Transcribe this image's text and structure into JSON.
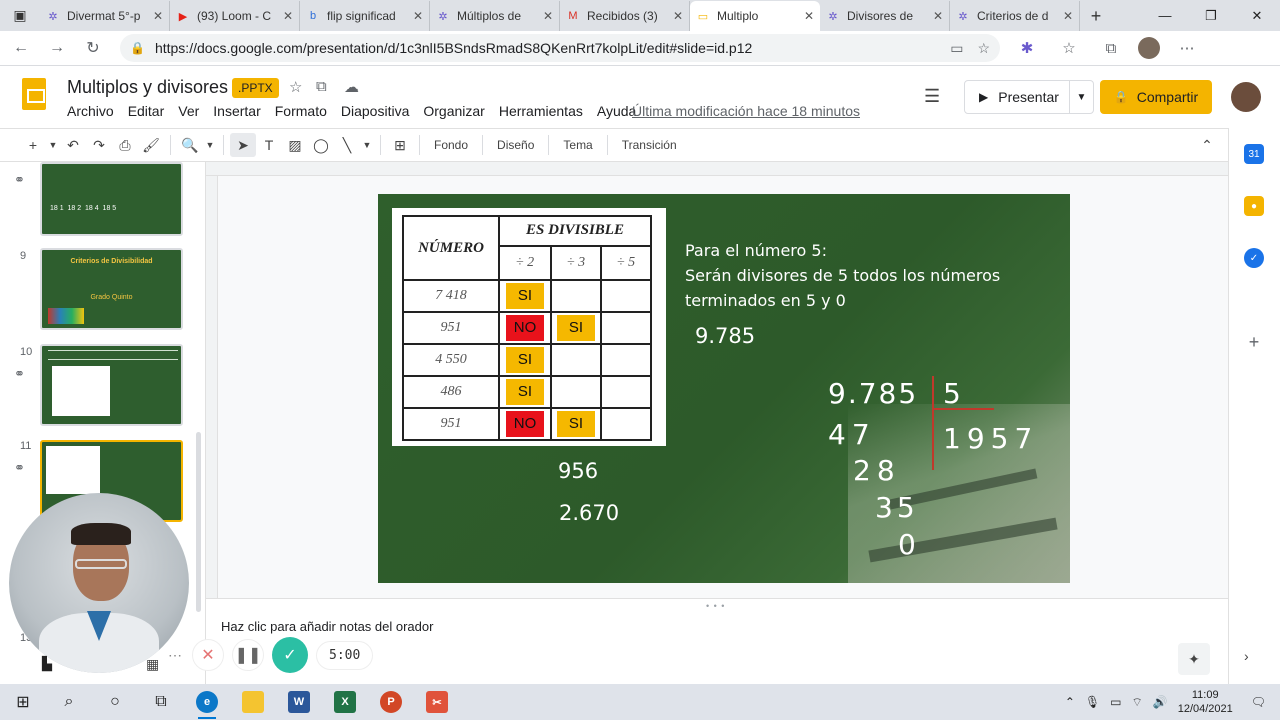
{
  "browser": {
    "tabs": [
      {
        "title": "Divermat 5°-p",
        "icon": "spark-icon",
        "color": "#6a5acd"
      },
      {
        "title": "(93) Loom - C",
        "icon": "youtube-icon",
        "color": "#e62117"
      },
      {
        "title": "flip significad",
        "icon": "bing-icon",
        "color": "#2f6fd8"
      },
      {
        "title": "Múltiplos de",
        "icon": "spark-icon",
        "color": "#6a5acd"
      },
      {
        "title": "Recibidos (3)",
        "icon": "gmail-icon",
        "color": "#d93025"
      },
      {
        "title": "Multiplo",
        "icon": "slides-icon",
        "color": "#f4b400",
        "active": true
      },
      {
        "title": "Divisores de",
        "icon": "spark-icon",
        "color": "#6a5acd"
      },
      {
        "title": "Criterios de d",
        "icon": "spark-icon",
        "color": "#6a5acd"
      }
    ],
    "url": "https://docs.google.com/presentation/d/1c3nlI5BSndsRmadS8QKenRrt7kolpLit/edit#slide=id.p12"
  },
  "app": {
    "title": "Multiplos y divisores",
    "badge": ".PPTX",
    "menu": [
      "Archivo",
      "Editar",
      "Ver",
      "Insertar",
      "Formato",
      "Diapositiva",
      "Organizar",
      "Herramientas",
      "Ayuda"
    ],
    "last_modified": "Última modificación hace 18 minutos",
    "present_label": "Presentar",
    "share_label": "Compartir"
  },
  "toolbar": {
    "background": "Fondo",
    "layout": "Diseño",
    "theme": "Tema",
    "transition": "Transición"
  },
  "filmstrip": [
    {
      "num": "",
      "top": 0,
      "preview_digits": [
        "18 1",
        "18 2",
        "18 4",
        "18 5"
      ]
    },
    {
      "num": "9",
      "title": "Criterios de Divisibilidad",
      "subtitle": "Grado Quinto"
    },
    {
      "num": "10"
    },
    {
      "num": "11"
    },
    {
      "num": "13"
    }
  ],
  "slide": {
    "table": {
      "header_number": "NÚMERO",
      "header_divisible": "ES DIVISIBLE",
      "cols": [
        "÷ 2",
        "÷ 3",
        "÷ 5"
      ],
      "rows": [
        {
          "number": "7 418",
          "d2": "SI",
          "d3": "",
          "d5": ""
        },
        {
          "number": "951",
          "d2": "NO",
          "d3": "SI",
          "d5": ""
        },
        {
          "number": "4 550",
          "d2": "SI",
          "d3": "",
          "d5": ""
        },
        {
          "number": "486",
          "d2": "SI",
          "d3": "",
          "d5": ""
        },
        {
          "number": "951",
          "d2": "NO",
          "d3": "SI",
          "d5": ""
        }
      ]
    },
    "rule_line1": "Para el número 5:",
    "rule_line2": "Serán divisores de 5 todos los números",
    "rule_line3": "terminados en 5 y 0",
    "example": "9.785",
    "extra1": "956",
    "extra2": "2.670",
    "division": {
      "dividend": "9.785",
      "divisor": "5",
      "quotient": "1957",
      "step1": "47",
      "step2": "28",
      "step3": "35",
      "remainder": "0"
    }
  },
  "notes_placeholder": "Haz clic para añadir notas del orador",
  "recorder": {
    "time": "5:00"
  },
  "taskbar": {
    "time": "11:09",
    "date": "12/04/2021"
  },
  "colors": {
    "accent": "#f4b400",
    "slide_green": "#2f5f2c",
    "si": "#f5b800",
    "no": "#e8121b"
  }
}
